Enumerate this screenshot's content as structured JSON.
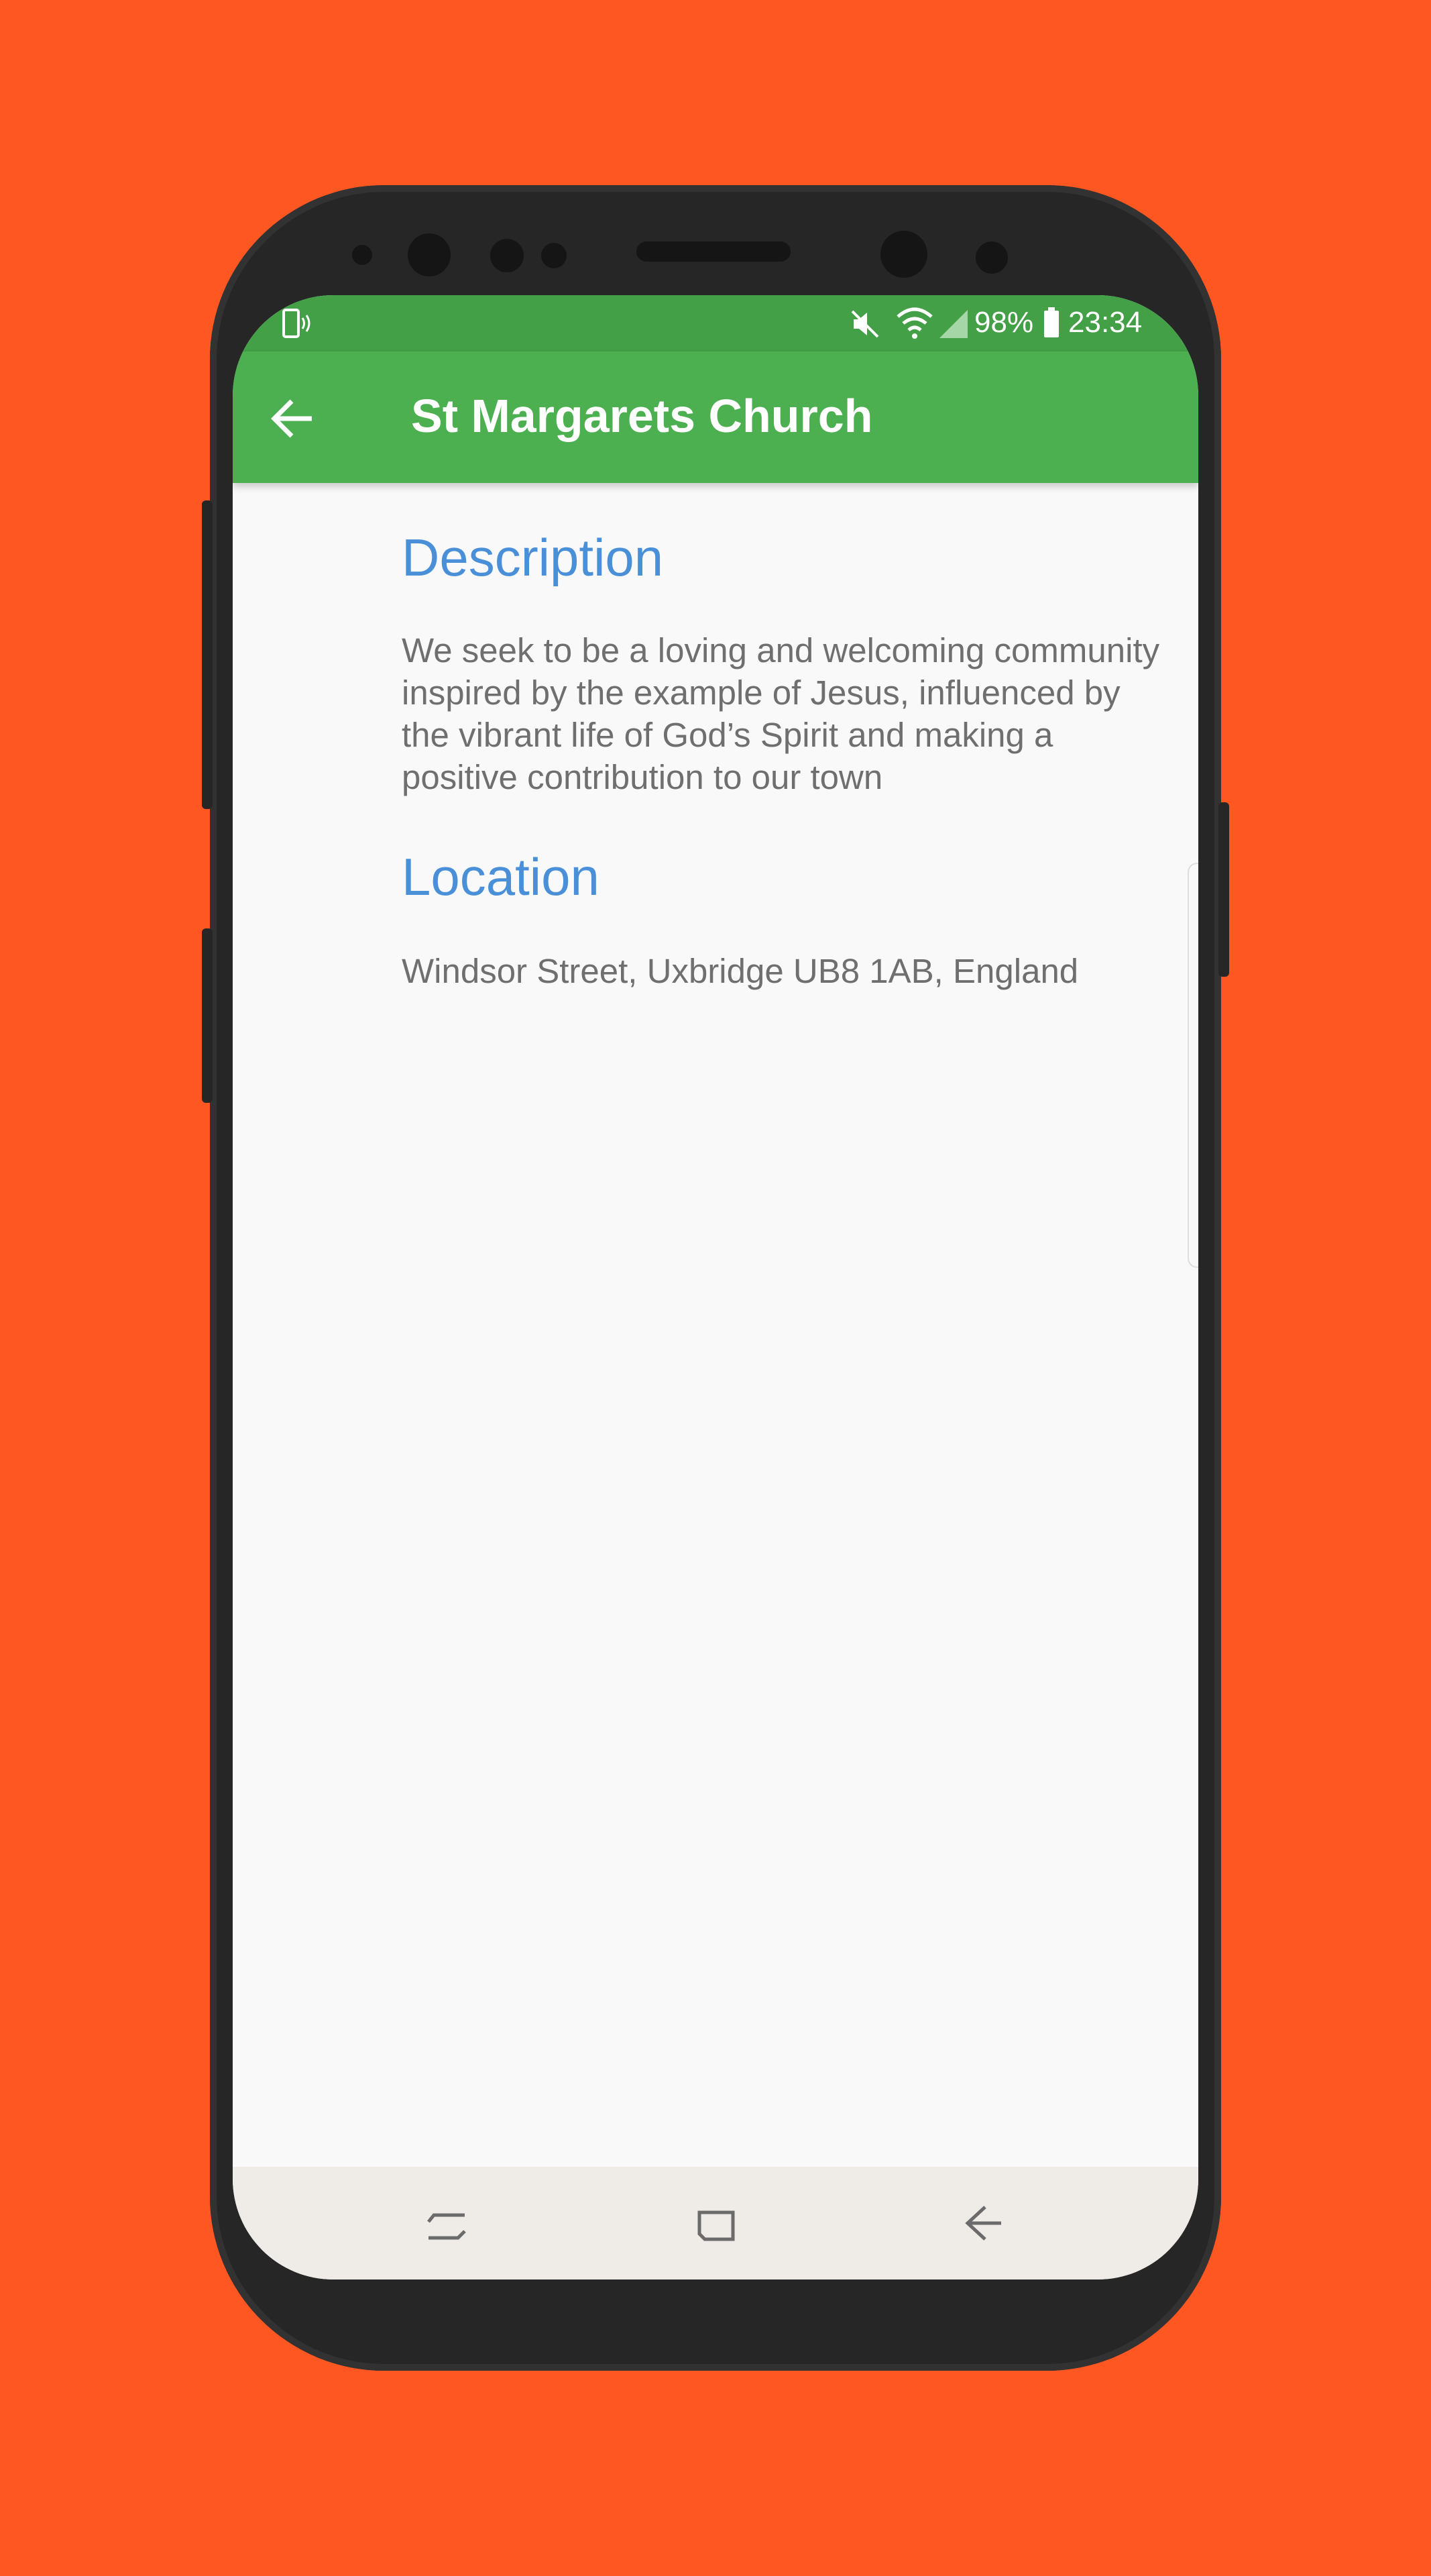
{
  "status_bar": {
    "battery": "98%",
    "time": "23:34",
    "icons": [
      "phone-vibrate-icon",
      "mute-icon",
      "wifi-icon",
      "signal-icon",
      "battery-icon"
    ]
  },
  "app_bar": {
    "title": "St Margarets Church",
    "back_icon": "arrow-back-icon",
    "color": "#4caf50"
  },
  "content": {
    "description_heading": "Description",
    "description_text": "We seek to be a loving and welcoming community inspired by the example of Jesus, influenced by the vibrant life of God’s Spirit and making a positive contribution to our town",
    "location_heading": "Location",
    "location_text": "Windsor Street, Uxbridge UB8 1AB, England",
    "heading_color": "#4a90d9"
  },
  "nav_bar": {
    "buttons": [
      "recent-apps-icon",
      "home-icon",
      "back-icon"
    ]
  },
  "background_color": "#ff5722"
}
